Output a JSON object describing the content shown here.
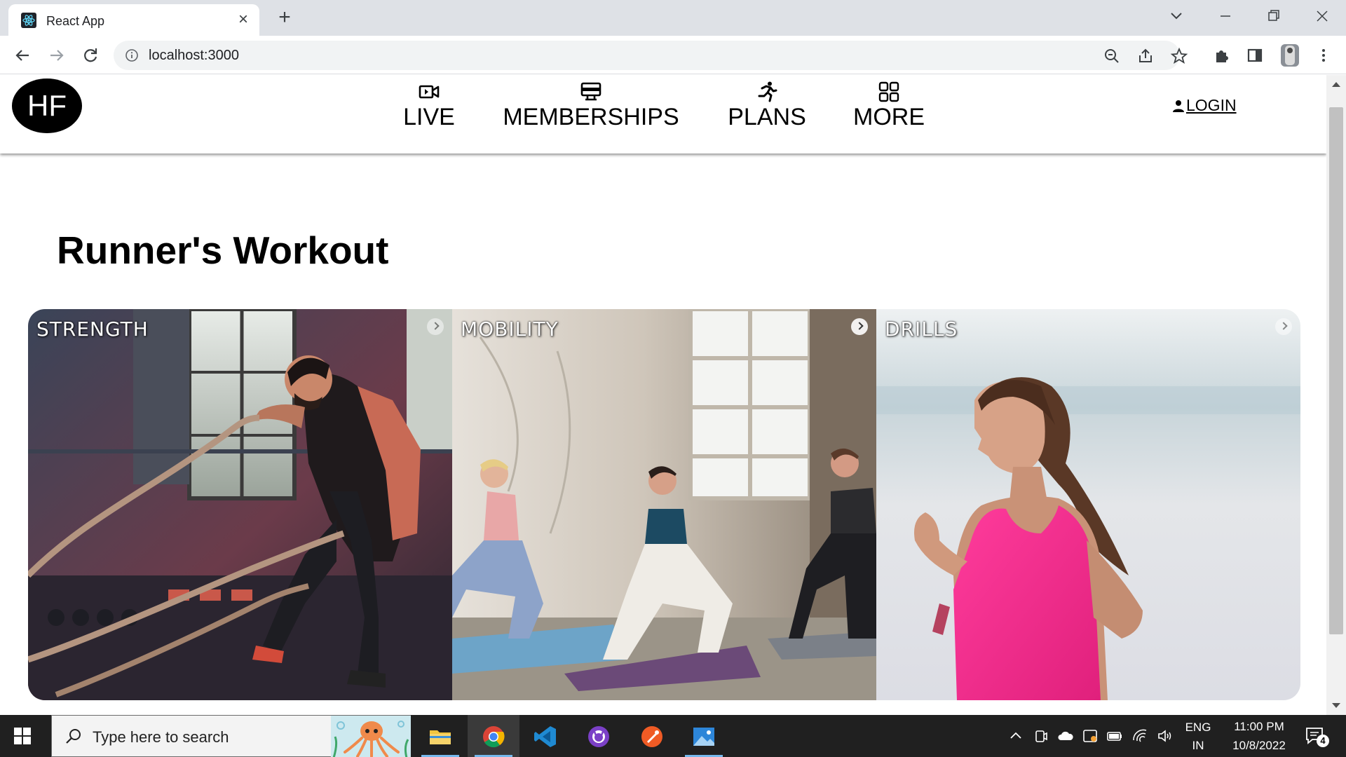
{
  "browser": {
    "tab_title": "React App",
    "url": "localhost:3000"
  },
  "site": {
    "logo_text": "HF",
    "nav": [
      {
        "label": "LIVE",
        "icon": "video-icon"
      },
      {
        "label": "MEMBERSHIPS",
        "icon": "card-icon"
      },
      {
        "label": "PLANS",
        "icon": "running-icon"
      },
      {
        "label": "MORE",
        "icon": "grid-icon"
      }
    ],
    "login_label": "LOGIN",
    "page_title": "Runner's Workout",
    "cards": [
      {
        "label": "STRENGTH",
        "photo": "man with battle ropes in gym"
      },
      {
        "label": "MOBILITY",
        "photo": "three women doing yoga stretches"
      },
      {
        "label": "DRILLS",
        "photo": "woman running on beach"
      }
    ]
  },
  "taskbar": {
    "search_placeholder": "Type here to search",
    "language_top": "ENG",
    "language_bottom": "IN",
    "time": "11:00 PM",
    "date": "10/8/2022",
    "notification_count": "4"
  },
  "colors": {
    "tabstrip": "#dee1e6",
    "taskbar": "#202020",
    "accent_pink": "#ff2d8a"
  }
}
